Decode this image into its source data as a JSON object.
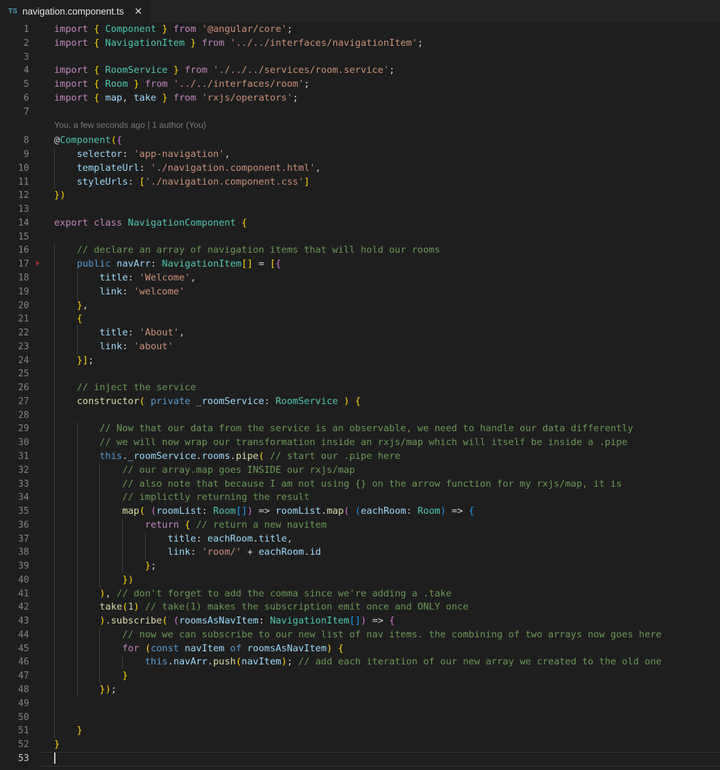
{
  "window": {
    "background": "#1e1e1e",
    "tabbar_background": "#252526"
  },
  "tabbar": {
    "tabs": [
      {
        "icon": "TS",
        "icon_name": "typescript-file-icon",
        "label": "navigation.component.ts",
        "close_label": "✕",
        "active": true
      }
    ]
  },
  "editor": {
    "language": "typescript",
    "cursor_line": 53,
    "total_lines": 53,
    "blame": {
      "after_line": 7,
      "text": "You, a few seconds ago | 1 author (You)"
    },
    "fold_markers": [
      {
        "line": 17,
        "state": "collapsed",
        "color": "#a03030"
      }
    ],
    "gutter_changes": [
      {
        "type": "modified",
        "from": 6,
        "to": 6,
        "color": "#0c7d9d"
      },
      {
        "type": "modified",
        "from": 29,
        "to": 30,
        "color": "#0c7d9d"
      },
      {
        "type": "modified",
        "from": 31,
        "to": 45,
        "color": "#0c7d9d"
      },
      {
        "type": "added",
        "from": 48,
        "to": 50,
        "color": "#587c0c"
      }
    ],
    "lines": [
      {
        "n": 1,
        "text": "import { Component } from '@angular/core';"
      },
      {
        "n": 2,
        "text": "import { NavigationItem } from '../../interfaces/navigationItem';"
      },
      {
        "n": 3,
        "text": ""
      },
      {
        "n": 4,
        "text": "import { RoomService } from './../../services/room.service';"
      },
      {
        "n": 5,
        "text": "import { Room } from '../../interfaces/room';"
      },
      {
        "n": 6,
        "text": "import { map, take } from 'rxjs/operators';"
      },
      {
        "n": 7,
        "text": ""
      },
      {
        "n": 8,
        "text": "@Component({"
      },
      {
        "n": 9,
        "text": "    selector: 'app-navigation',"
      },
      {
        "n": 10,
        "text": "    templateUrl: './navigation.component.html',"
      },
      {
        "n": 11,
        "text": "    styleUrls: ['./navigation.component.css']"
      },
      {
        "n": 12,
        "text": "})"
      },
      {
        "n": 13,
        "text": ""
      },
      {
        "n": 14,
        "text": "export class NavigationComponent {"
      },
      {
        "n": 15,
        "text": ""
      },
      {
        "n": 16,
        "text": "    // declare an array of navigation items that will hold our rooms"
      },
      {
        "n": 17,
        "text": "    public navArr: NavigationItem[] = [{"
      },
      {
        "n": 18,
        "text": "        title: 'Welcome',"
      },
      {
        "n": 19,
        "text": "        link: 'welcome'"
      },
      {
        "n": 20,
        "text": "    },"
      },
      {
        "n": 21,
        "text": "    {"
      },
      {
        "n": 22,
        "text": "        title: 'About',"
      },
      {
        "n": 23,
        "text": "        link: 'about'"
      },
      {
        "n": 24,
        "text": "    }];"
      },
      {
        "n": 25,
        "text": ""
      },
      {
        "n": 26,
        "text": "    // inject the service"
      },
      {
        "n": 27,
        "text": "    constructor( private _roomService: RoomService ) {"
      },
      {
        "n": 28,
        "text": ""
      },
      {
        "n": 29,
        "text": "        // Now that our data from the service is an observable, we need to handle our data differently"
      },
      {
        "n": 30,
        "text": "        // we will now wrap our transformation inside an rxjs/map which will itself be inside a .pipe"
      },
      {
        "n": 31,
        "text": "        this._roomService.rooms.pipe( // start our .pipe here"
      },
      {
        "n": 32,
        "text": "            // our array.map goes INSIDE our rxjs/map"
      },
      {
        "n": 33,
        "text": "            // also note that because I am not using {} on the arrow function for my rxjs/map, it is"
      },
      {
        "n": 34,
        "text": "            // implictly returning the result"
      },
      {
        "n": 35,
        "text": "            map( (roomList: Room[]) => roomList.map( (eachRoom: Room) => {"
      },
      {
        "n": 36,
        "text": "                return { // return a new navitem"
      },
      {
        "n": 37,
        "text": "                    title: eachRoom.title,"
      },
      {
        "n": 38,
        "text": "                    link: 'room/' + eachRoom.id"
      },
      {
        "n": 39,
        "text": "                };"
      },
      {
        "n": 40,
        "text": "            })"
      },
      {
        "n": 41,
        "text": "        ), // don't forget to add the comma since we're adding a .take"
      },
      {
        "n": 42,
        "text": "        take(1) // take(1) makes the subscription emit once and ONLY once"
      },
      {
        "n": 43,
        "text": "        ).subscribe( (roomsAsNavItem: NavigationItem[]) => {"
      },
      {
        "n": 44,
        "text": "            // now we can subscribe to our new list of nav items. the combining of two arrays now goes here"
      },
      {
        "n": 45,
        "text": "            for (const navItem of roomsAsNavItem) {"
      },
      {
        "n": 46,
        "text": "                this.navArr.push(navItem); // add each iteration of our new array we created to the old one"
      },
      {
        "n": 47,
        "text": "            }"
      },
      {
        "n": 48,
        "text": "        });"
      },
      {
        "n": 49,
        "text": ""
      },
      {
        "n": 50,
        "text": ""
      },
      {
        "n": 51,
        "text": "    }"
      },
      {
        "n": 52,
        "text": "}"
      },
      {
        "n": 53,
        "text": ""
      }
    ]
  },
  "colors": {
    "keyword": "#c586c0",
    "keyword_alt": "#569cd6",
    "type": "#4ec9b0",
    "string": "#ce9178",
    "comment": "#6a9955",
    "function": "#dcdcaa",
    "variable": "#9cdcfe",
    "number": "#b5cea8",
    "bracket_l0": "#ffd700",
    "bracket_l1": "#da70d6",
    "bracket_l2": "#179fff",
    "foreground": "#d4d4d4",
    "gutter_modified": "#0c7d9d",
    "gutter_added": "#587c0c",
    "fold_marker": "#a03030",
    "cursor": "#c8c8c8"
  }
}
